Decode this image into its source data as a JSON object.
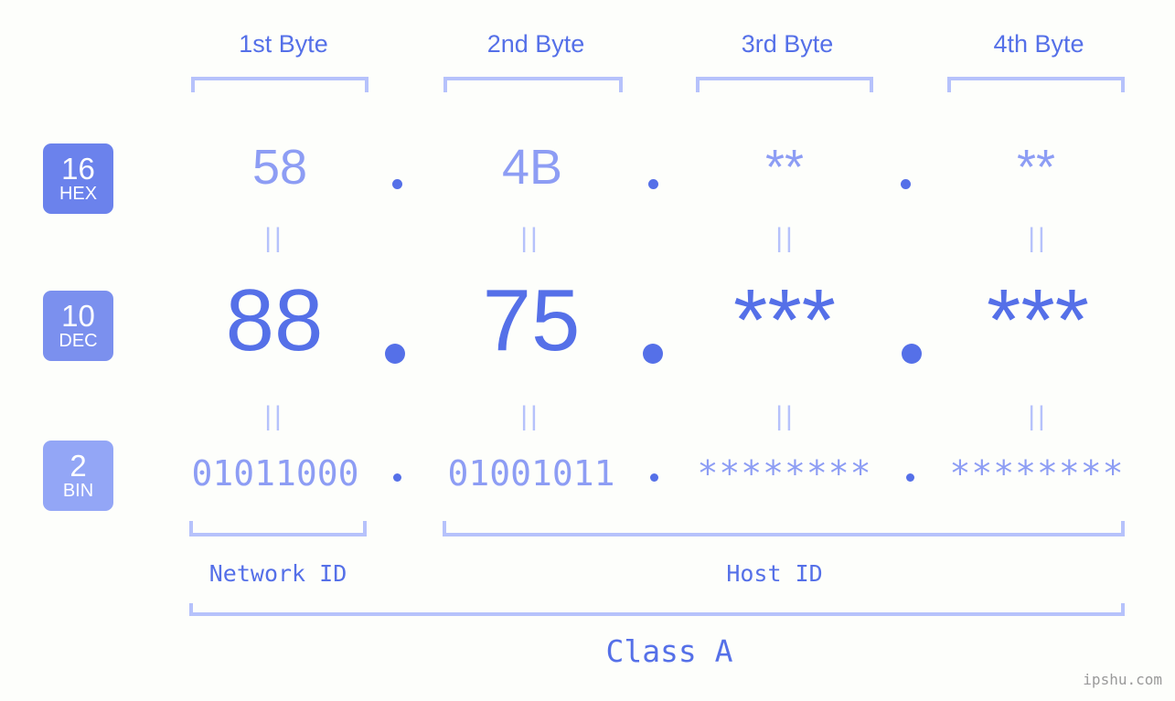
{
  "page": {
    "background_color": "#fdfefb",
    "accent_strong": "#5570e8",
    "accent_light": "#8d9df4",
    "accent_pale": "#b6c2fb",
    "watermark": "ipshu.com"
  },
  "byte_headers": [
    {
      "label": "1st Byte"
    },
    {
      "label": "2nd Byte"
    },
    {
      "label": "3rd Byte"
    },
    {
      "label": "4th Byte"
    }
  ],
  "bases": [
    {
      "number": "16",
      "name": "HEX",
      "color": "#6b82ec"
    },
    {
      "number": "10",
      "name": "DEC",
      "color": "#7b90ee"
    },
    {
      "number": "2",
      "name": "BIN",
      "color": "#93a6f6"
    }
  ],
  "rows": {
    "hex": {
      "base_number": "16",
      "base_name": "HEX",
      "values": [
        "58",
        "4B",
        "**",
        "**"
      ],
      "separator": "."
    },
    "dec": {
      "base_number": "10",
      "base_name": "DEC",
      "values": [
        "88",
        "75",
        "***",
        "***"
      ],
      "separator": "."
    },
    "bin": {
      "base_number": "2",
      "base_name": "BIN",
      "values": [
        "01011000",
        "01001011",
        "********",
        "********"
      ],
      "separator": "."
    }
  },
  "equals_marks": {
    "glyph": "||",
    "count_per_row": 4
  },
  "segments": {
    "network_id": "Network ID",
    "host_id": "Host ID",
    "class": "Class A"
  }
}
